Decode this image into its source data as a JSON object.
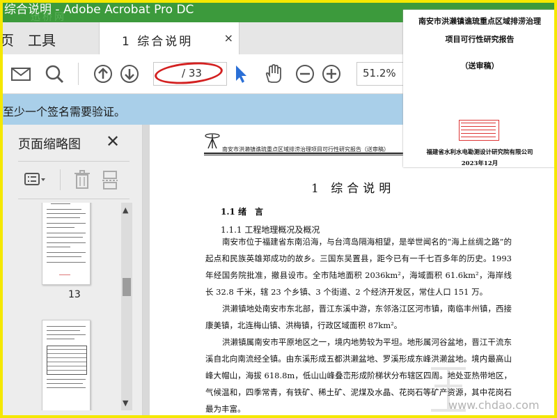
{
  "window": {
    "title": "综合说明 - Adobe Acrobat Pro DC",
    "watermark": "迅桥网"
  },
  "tabs": {
    "home_label": "页",
    "tools_label": "工具",
    "document_tab_label": "1 综合说明",
    "close_glyph": "×"
  },
  "toolbar": {
    "icons": [
      "mail-icon",
      "search-icon",
      "prev-page-icon",
      "next-page-icon",
      "select-cursor-icon",
      "hand-icon",
      "zoom-out-icon",
      "zoom-in-icon"
    ],
    "page_input_value": "",
    "page_total": "/ 33",
    "zoom_value": "51.2%"
  },
  "signature_bar": {
    "message": "至少一个签名需要验证。"
  },
  "thumbnail_panel": {
    "title": "页面缩略图",
    "thumbnails": [
      {
        "page_label": "13"
      },
      {
        "page_label": ""
      }
    ]
  },
  "document": {
    "header_text": "南安市洪濑镇谯琉重点区域排涝治理项目可行性研究报告（送审稿）",
    "chapter_title": "1 综合说明",
    "section_title": "1.1 绪　言",
    "subsection_title": "1.1.1 工程地理概况及概况",
    "paragraphs": [
      "南安市位于福建省东南沿海，与台湾岛隔海相望，是举世闻名的“海上丝绸之路”的起点和民族英雄郑成功的故乡。三国东吴置县，距今已有一千七百多年的历史。1993 年经国务院批准，撤县设市。全市陆地面积 2036km²，海域面积 61.6km²，海岸线长 32.8 千米，辖 23 个乡镇、3 个街道、2 个经济开发区，常住人口 151 万。",
      "洪濑镇地处南安市东北部，晋江东溪中游，东邻洛江区河市镇，南临丰州镇，西接康美镇，北连梅山镇、洪梅镇，行政区域面积 87km²。",
      "洪濑镇属南安市平原地区之一，境内地势较为平坦。地形属河谷盆地，晋江干流东溪自北向南流经全镇。由东溪形成五都洪濑盆地、罗溪形成东峰洪濑盆地。境内最高山峰大帽山，海拔 618.8m，低山山峰叠峦形成阶梯状分布辖区四周。地处亚热带地区，气候温和，四季常青，有铁矿、稀土矿、泥煤及水晶、花岗石等矿产资源，其中花岗石最为丰富。"
    ]
  },
  "cover": {
    "title_line1": "南安市洪濑镇谯琉重点区域排涝治理",
    "title_line2": "项目可行性研究报告",
    "draft_label": "（送审稿）",
    "company": "福建省水利水电勘测设计研究院有限公司",
    "date": "2023年12月"
  },
  "watermark_bottom": "www.chdao.com"
}
